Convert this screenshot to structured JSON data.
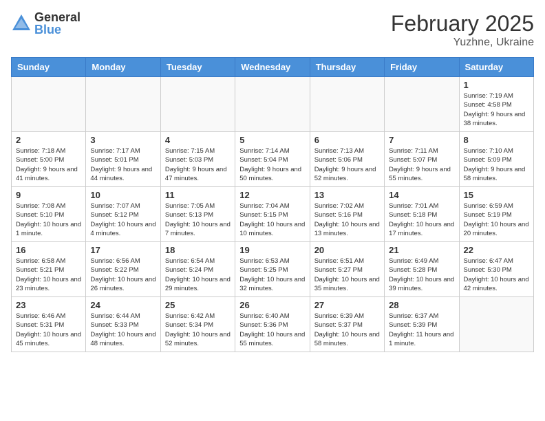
{
  "header": {
    "logo_general": "General",
    "logo_blue": "Blue",
    "month_year": "February 2025",
    "location": "Yuzhne, Ukraine"
  },
  "days_of_week": [
    "Sunday",
    "Monday",
    "Tuesday",
    "Wednesday",
    "Thursday",
    "Friday",
    "Saturday"
  ],
  "weeks": [
    [
      {
        "day": "",
        "info": ""
      },
      {
        "day": "",
        "info": ""
      },
      {
        "day": "",
        "info": ""
      },
      {
        "day": "",
        "info": ""
      },
      {
        "day": "",
        "info": ""
      },
      {
        "day": "",
        "info": ""
      },
      {
        "day": "1",
        "info": "Sunrise: 7:19 AM\nSunset: 4:58 PM\nDaylight: 9 hours and 38 minutes."
      }
    ],
    [
      {
        "day": "2",
        "info": "Sunrise: 7:18 AM\nSunset: 5:00 PM\nDaylight: 9 hours and 41 minutes."
      },
      {
        "day": "3",
        "info": "Sunrise: 7:17 AM\nSunset: 5:01 PM\nDaylight: 9 hours and 44 minutes."
      },
      {
        "day": "4",
        "info": "Sunrise: 7:15 AM\nSunset: 5:03 PM\nDaylight: 9 hours and 47 minutes."
      },
      {
        "day": "5",
        "info": "Sunrise: 7:14 AM\nSunset: 5:04 PM\nDaylight: 9 hours and 50 minutes."
      },
      {
        "day": "6",
        "info": "Sunrise: 7:13 AM\nSunset: 5:06 PM\nDaylight: 9 hours and 52 minutes."
      },
      {
        "day": "7",
        "info": "Sunrise: 7:11 AM\nSunset: 5:07 PM\nDaylight: 9 hours and 55 minutes."
      },
      {
        "day": "8",
        "info": "Sunrise: 7:10 AM\nSunset: 5:09 PM\nDaylight: 9 hours and 58 minutes."
      }
    ],
    [
      {
        "day": "9",
        "info": "Sunrise: 7:08 AM\nSunset: 5:10 PM\nDaylight: 10 hours and 1 minute."
      },
      {
        "day": "10",
        "info": "Sunrise: 7:07 AM\nSunset: 5:12 PM\nDaylight: 10 hours and 4 minutes."
      },
      {
        "day": "11",
        "info": "Sunrise: 7:05 AM\nSunset: 5:13 PM\nDaylight: 10 hours and 7 minutes."
      },
      {
        "day": "12",
        "info": "Sunrise: 7:04 AM\nSunset: 5:15 PM\nDaylight: 10 hours and 10 minutes."
      },
      {
        "day": "13",
        "info": "Sunrise: 7:02 AM\nSunset: 5:16 PM\nDaylight: 10 hours and 13 minutes."
      },
      {
        "day": "14",
        "info": "Sunrise: 7:01 AM\nSunset: 5:18 PM\nDaylight: 10 hours and 17 minutes."
      },
      {
        "day": "15",
        "info": "Sunrise: 6:59 AM\nSunset: 5:19 PM\nDaylight: 10 hours and 20 minutes."
      }
    ],
    [
      {
        "day": "16",
        "info": "Sunrise: 6:58 AM\nSunset: 5:21 PM\nDaylight: 10 hours and 23 minutes."
      },
      {
        "day": "17",
        "info": "Sunrise: 6:56 AM\nSunset: 5:22 PM\nDaylight: 10 hours and 26 minutes."
      },
      {
        "day": "18",
        "info": "Sunrise: 6:54 AM\nSunset: 5:24 PM\nDaylight: 10 hours and 29 minutes."
      },
      {
        "day": "19",
        "info": "Sunrise: 6:53 AM\nSunset: 5:25 PM\nDaylight: 10 hours and 32 minutes."
      },
      {
        "day": "20",
        "info": "Sunrise: 6:51 AM\nSunset: 5:27 PM\nDaylight: 10 hours and 35 minutes."
      },
      {
        "day": "21",
        "info": "Sunrise: 6:49 AM\nSunset: 5:28 PM\nDaylight: 10 hours and 39 minutes."
      },
      {
        "day": "22",
        "info": "Sunrise: 6:47 AM\nSunset: 5:30 PM\nDaylight: 10 hours and 42 minutes."
      }
    ],
    [
      {
        "day": "23",
        "info": "Sunrise: 6:46 AM\nSunset: 5:31 PM\nDaylight: 10 hours and 45 minutes."
      },
      {
        "day": "24",
        "info": "Sunrise: 6:44 AM\nSunset: 5:33 PM\nDaylight: 10 hours and 48 minutes."
      },
      {
        "day": "25",
        "info": "Sunrise: 6:42 AM\nSunset: 5:34 PM\nDaylight: 10 hours and 52 minutes."
      },
      {
        "day": "26",
        "info": "Sunrise: 6:40 AM\nSunset: 5:36 PM\nDaylight: 10 hours and 55 minutes."
      },
      {
        "day": "27",
        "info": "Sunrise: 6:39 AM\nSunset: 5:37 PM\nDaylight: 10 hours and 58 minutes."
      },
      {
        "day": "28",
        "info": "Sunrise: 6:37 AM\nSunset: 5:39 PM\nDaylight: 11 hours and 1 minute."
      },
      {
        "day": "",
        "info": ""
      }
    ]
  ]
}
